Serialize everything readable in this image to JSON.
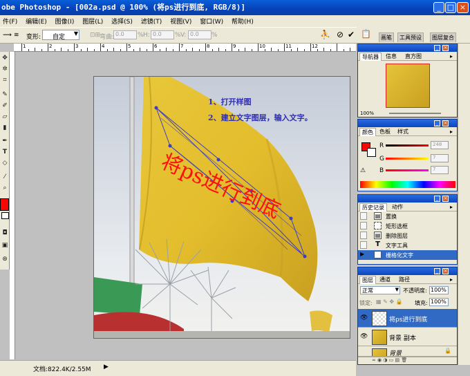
{
  "window": {
    "title": "obe Photoshop - [002a.psd @ 100% (将ps进行到底, RGB/8)]",
    "buttons": [
      "_",
      "□",
      "×"
    ]
  },
  "menu": [
    "件(F)",
    "编辑(E)",
    "图像(I)",
    "图层(L)",
    "选择(S)",
    "滤镜(T)",
    "视图(V)",
    "窗口(W)",
    "帮助(H)"
  ],
  "options": {
    "transform_label": "变形:",
    "transform_value": "自定",
    "bend_label": "弯曲:",
    "bend_value": "0.0",
    "h_label": "H:",
    "h_value": "0.0",
    "v_label": "V:",
    "v_value": "0.0",
    "pct": "%"
  },
  "dock_tabs": [
    "画笔",
    "工具预设",
    "图层复合"
  ],
  "ruler_labels": [
    "1",
    "2",
    "3",
    "4",
    "5",
    "6",
    "7",
    "8",
    "9",
    "10",
    "11",
    "12"
  ],
  "image": {
    "flag_text": "将ps进行到底",
    "step1": "1、打开样图",
    "step2": "2、建立文字图层，输入文字。"
  },
  "status": {
    "doc": "文档:822.4K/2.55M",
    "arrow": "▶"
  },
  "navigator": {
    "tabs": [
      "导航器",
      "信息",
      "直方图"
    ],
    "zoom": "100%"
  },
  "color": {
    "tabs": [
      "颜色",
      "色板",
      "样式"
    ],
    "r_label": "R",
    "r_value": "248",
    "g_label": "G",
    "g_value": "7",
    "b_label": "B",
    "b_value": "7",
    "warn": "⚠"
  },
  "history": {
    "tabs": [
      "历史记录",
      "动作"
    ],
    "items": [
      "置换",
      "矩形选框",
      "删除图层",
      "文字工具",
      "栅格化文字"
    ]
  },
  "layers": {
    "tabs": [
      "图层",
      "通道",
      "路径"
    ],
    "blend_mode": "正常",
    "opacity_label": "不透明度:",
    "opacity_value": "100%",
    "lock_label": "锁定:",
    "fill_label": "填充:",
    "fill_value": "100%",
    "items": [
      "将ps进行到底",
      "背景 副本",
      "背景"
    ],
    "bottom_icons": "∞ ◉ ◑ ▭ ▤ 🗑"
  }
}
